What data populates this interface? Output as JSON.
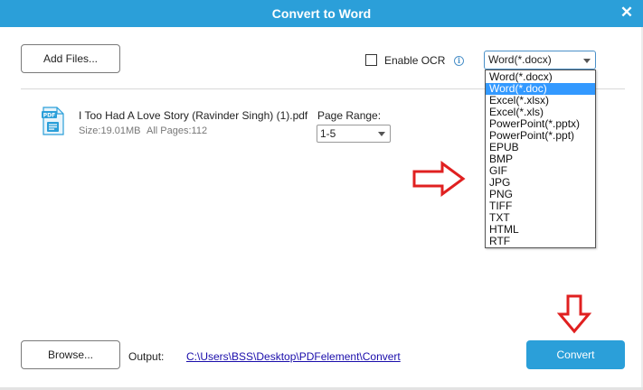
{
  "window": {
    "title": "Convert to Word",
    "close_icon": "close-icon",
    "accent_color": "#2b9fd9"
  },
  "toolbar": {
    "add_files_label": "Add Files...",
    "ocr_label": "Enable OCR",
    "ocr_checked": false,
    "info_icon": "info-icon",
    "format_selected": "Word(*.docx)"
  },
  "format_dropdown": {
    "highlighted": "Word(*.doc)",
    "options": [
      "Word(*.docx)",
      "Word(*.doc)",
      "Excel(*.xlsx)",
      "Excel(*.xls)",
      "PowerPoint(*.pptx)",
      "PowerPoint(*.ppt)",
      "EPUB",
      "BMP",
      "GIF",
      "JPG",
      "PNG",
      "TIFF",
      "TXT",
      "HTML",
      "RTF"
    ]
  },
  "file": {
    "icon": "pdf-file-icon",
    "name": "I Too Had A Love Story (Ravinder Singh) (1).pdf",
    "size": "Size:19.01MB",
    "pages": "All Pages:112",
    "page_range_label": "Page Range:",
    "page_range_value": "1-5"
  },
  "footer": {
    "browse_label": "Browse...",
    "output_label": "Output:",
    "output_path": "C:\\Users\\BSS\\Desktop\\PDFelement\\Convert",
    "convert_label": "Convert"
  },
  "annotations": {
    "arrow_color": "#e02020"
  }
}
